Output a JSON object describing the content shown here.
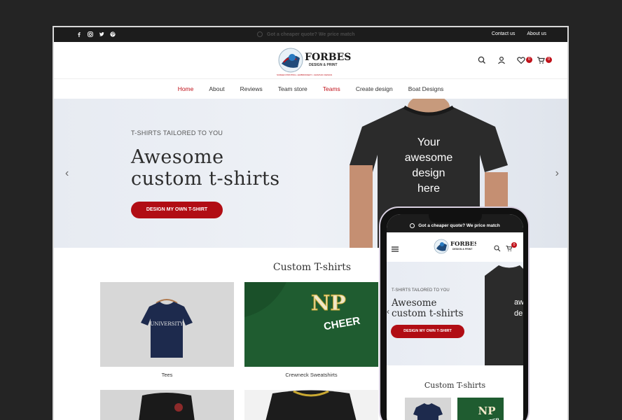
{
  "topbar": {
    "promo": "Got a cheaper quote? We price match",
    "links": [
      "Contact us",
      "About us"
    ]
  },
  "header": {
    "brand": "FORBES",
    "brand_sub": "DESIGN & PRINT",
    "tagline": "SCREEN PRINTING • EMBROIDERY • GRAPHIC DESIGN",
    "wishlist_count": "0",
    "cart_count": "0"
  },
  "nav": [
    "Home",
    "About",
    "Reviews",
    "Team store",
    "Teams",
    "Create design",
    "Boat Designs"
  ],
  "hero": {
    "subtitle": "T-SHIRTS TAILORED TO YOU",
    "title_line1": "Awesome",
    "title_line2": "custom t-shirts",
    "button": "DESIGN MY OWN T-SHIRT",
    "shirt_text": [
      "Your",
      "awesome",
      "design",
      "here"
    ]
  },
  "section": {
    "title": "Custom T-shirts",
    "cards": [
      {
        "label": "Tees",
        "print": "UNIVERSITY"
      },
      {
        "label": "Crewneck Sweatshirts",
        "print": "CHEER"
      }
    ]
  },
  "mobile": {
    "promo": "Got a cheaper quote? We price match",
    "cart_count": "0",
    "hero_title_line1": "Awesome",
    "hero_title_line2": "custom t-shirts",
    "hero_subtitle": "T-SHIRTS TAILORED TO YOU",
    "button": "DESIGN MY OWN T-SHIRT",
    "section_title": "Custom T-shirts",
    "shirt_fragment": [
      "aw",
      "de"
    ]
  },
  "colors": {
    "accent": "#b10d14",
    "topbar": "#1c1c1c"
  }
}
